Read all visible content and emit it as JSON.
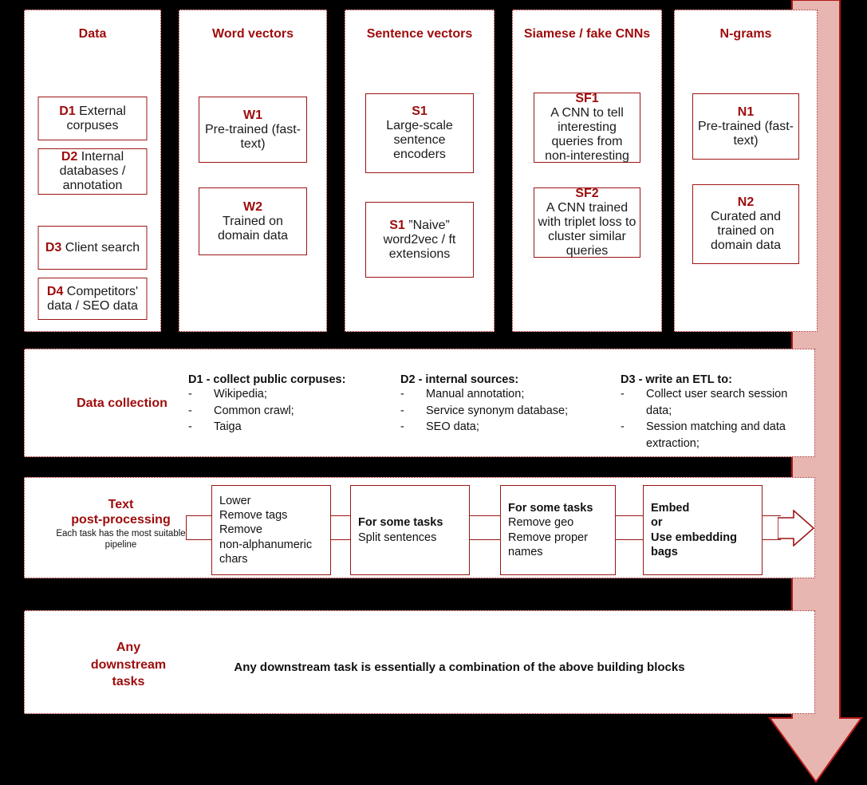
{
  "colors": {
    "accent_red": "#9e0b0b",
    "box_border": "#9c1515",
    "arrow_fill": "#e8b6b0",
    "arrow_stroke": "#b01818",
    "background": "#000000",
    "panel": "#ffffff"
  },
  "columns": [
    {
      "title": "Data",
      "cards": [
        {
          "code": "D1",
          "text": "External corpuses",
          "size": "big"
        },
        {
          "code": "D2",
          "text": "Internal databases / annotation",
          "size": "big"
        },
        {
          "code": "D3",
          "text": "Client search",
          "size": "big"
        },
        {
          "code": "D4",
          "text": "Competitors' data / SEO data",
          "size": "small"
        }
      ]
    },
    {
      "title": "Word vectors",
      "cards": [
        {
          "code": "W1",
          "text": "Pre-trained (fast-text)",
          "size": "big",
          "stacked": true
        },
        {
          "code": "W2",
          "text": "Trained on domain data",
          "size": "big",
          "stacked": true
        }
      ]
    },
    {
      "title": "Sentence vectors",
      "cards": [
        {
          "code": "S1",
          "text": "Large-scale sentence encoders",
          "size": "big",
          "stacked": true
        },
        {
          "code": "S1",
          "text": "”Naive” word2vec / ft extensions",
          "size": "big"
        }
      ]
    },
    {
      "title": "Siamese / fake CNNs",
      "cards": [
        {
          "code": "SF1",
          "text": "A CNN to tell interesting queries from non-interesting",
          "size": "small",
          "stacked": true
        },
        {
          "code": "SF2",
          "text": "A CNN trained with triplet loss to cluster similar queries",
          "size": "small",
          "stacked": true
        }
      ]
    },
    {
      "title": "N-grams",
      "cards": [
        {
          "code": "N1",
          "text": "Pre-trained (fast-text)",
          "size": "big",
          "stacked": true
        },
        {
          "code": "N2",
          "text": "Curated and trained on domain data",
          "size": "big",
          "stacked": true
        }
      ]
    }
  ],
  "data_collection": {
    "label": "Data collection",
    "groups": [
      {
        "heading": "D1 - collect public corpuses:",
        "items": [
          "Wikipedia;",
          "Common crawl;",
          "Taiga"
        ]
      },
      {
        "heading": "D2 - internal sources:",
        "items": [
          "Manual annotation;",
          "Service synonym database;",
          "SEO data;"
        ]
      },
      {
        "heading": "D3 - write an ETL to:",
        "items": [
          "Collect user search session data;",
          "Session matching and data extraction;"
        ]
      }
    ],
    "bullet_dash": "-"
  },
  "post_processing": {
    "label_line1": "Text",
    "label_line2": "post-processing",
    "sublabel": "Each task has the most suitable pipeline",
    "steps": [
      {
        "bold": "",
        "lines": [
          "Lower",
          "Remove tags",
          "Remove",
          "non-alphanumeric",
          "chars"
        ]
      },
      {
        "bold": "For some tasks",
        "lines": [
          "Split sentences"
        ]
      },
      {
        "bold": "For some tasks",
        "lines": [
          "Remove geo",
          "Remove proper",
          "names"
        ]
      },
      {
        "bold_lines": [
          "Embed",
          "or",
          "Use embedding",
          "bags"
        ],
        "lines": []
      }
    ]
  },
  "downstream": {
    "label_line1": "Any",
    "label_line2": "downstream",
    "label_line3": "tasks",
    "note": "Any downstream task is essentially a combination of the above building blocks"
  },
  "flow_arrow": {
    "name": "pipeline-flow-arrow",
    "direction": "down"
  }
}
